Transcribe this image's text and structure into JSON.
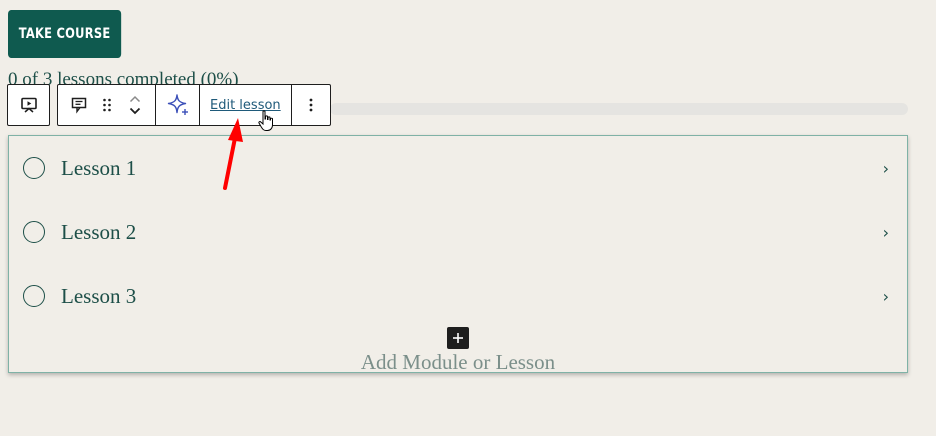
{
  "course": {
    "take_course_label": "TAKE COURSE",
    "progress_text": "0 of 3 lessons completed (0%)",
    "progress_value": 0
  },
  "toolbar": {
    "edit_lesson_label": "Edit lesson",
    "icons": [
      "slideshow-icon",
      "lesson-block-icon",
      "drag-handle-icon",
      "move-up-icon",
      "move-down-icon",
      "sparkle-icon",
      "more-options-icon"
    ]
  },
  "lessons": [
    {
      "title": "Lesson 1"
    },
    {
      "title": "Lesson 2"
    },
    {
      "title": "Lesson 3"
    }
  ],
  "add": {
    "label": "Add Module or Lesson"
  },
  "colors": {
    "background": "#f1eee8",
    "brand": "#0f5a4f",
    "text": "#1d4f48",
    "annotation_arrow": "#ff0000"
  }
}
